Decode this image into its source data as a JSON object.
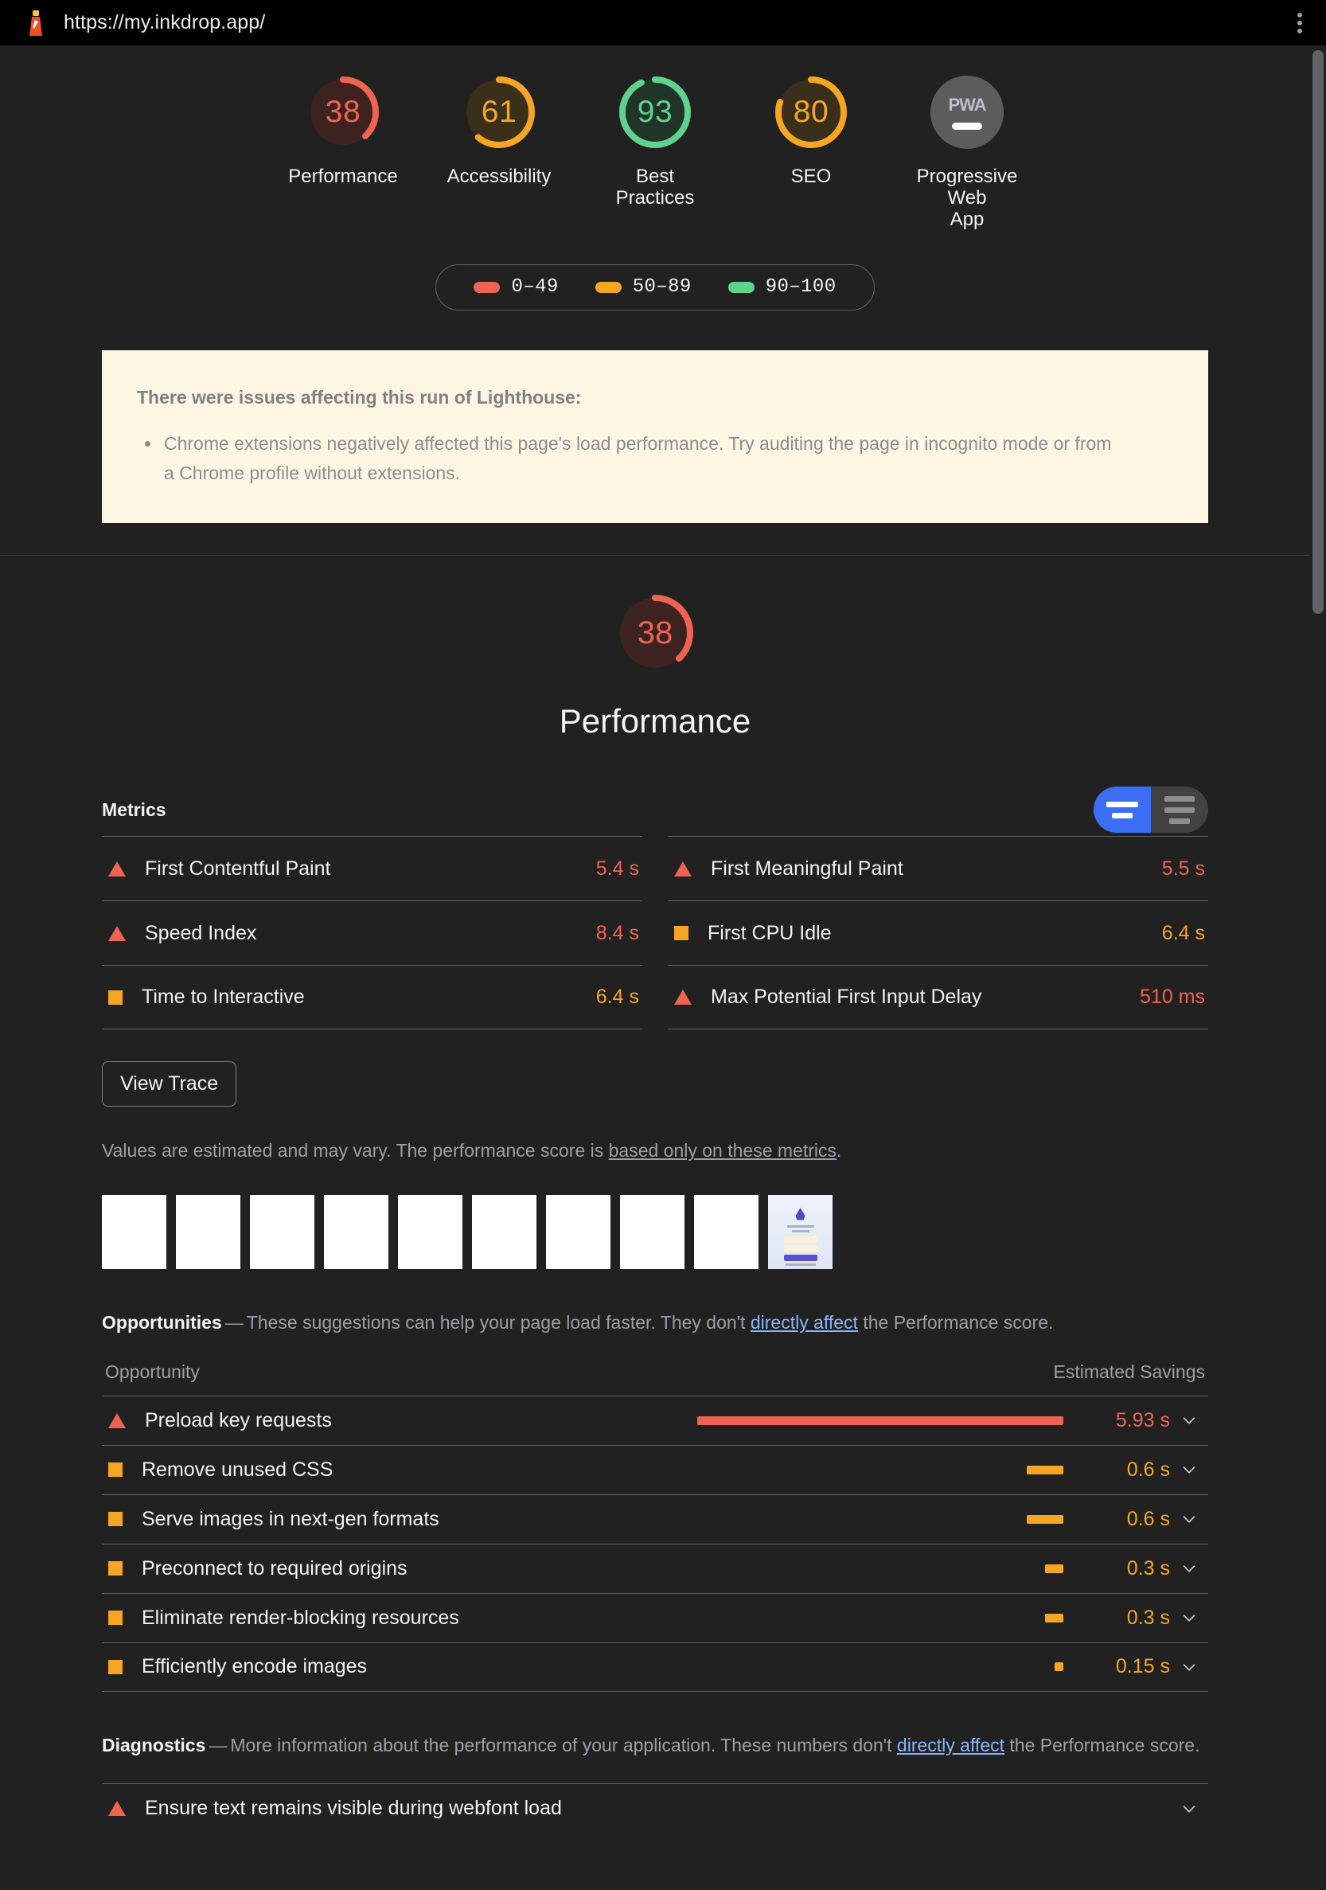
{
  "browser": {
    "url": "https://my.inkdrop.app/",
    "favicon_icon": "lighthouse-icon",
    "menu_icon": "kebab-menu-icon"
  },
  "colors": {
    "fail": "#ee6352",
    "average": "#f5a623",
    "pass": "#5fd38c",
    "fail_bg": "#3c2320",
    "average_bg": "#3a2f1b",
    "pass_bg": "#21342a",
    "link": "#8ab4f8",
    "accent_blue": "#3b6ef5"
  },
  "scores": [
    {
      "value": "38",
      "label": "Performance",
      "rating": "fail"
    },
    {
      "value": "61",
      "label": "Accessibility",
      "rating": "average"
    },
    {
      "value": "93",
      "label": "Best Practices",
      "rating": "pass"
    },
    {
      "value": "80",
      "label": "SEO",
      "rating": "average"
    },
    {
      "value": "PWA",
      "label": "Progressive Web App",
      "rating": "none"
    }
  ],
  "legend": [
    {
      "range": "0–49",
      "color": "#ee6352"
    },
    {
      "range": "50–89",
      "color": "#f5a623"
    },
    {
      "range": "90–100",
      "color": "#5fd38c"
    }
  ],
  "warning": {
    "title": "There were issues affecting this run of Lighthouse:",
    "items": [
      "Chrome extensions negatively affected this page's load performance. Try auditing the page in incognito mode or from a Chrome profile without extensions."
    ]
  },
  "performance": {
    "score": "38",
    "rating": "fail",
    "title": "Performance",
    "metrics_heading": "Metrics",
    "toggle": {
      "expanded_icon": "collapsed-view-icon",
      "description_icon": "description-view-icon"
    },
    "metrics_left": [
      {
        "name": "First Contentful Paint",
        "value": "5.4 s",
        "rating": "fail"
      },
      {
        "name": "Speed Index",
        "value": "8.4 s",
        "rating": "fail"
      },
      {
        "name": "Time to Interactive",
        "value": "6.4 s",
        "rating": "average"
      }
    ],
    "metrics_right": [
      {
        "name": "First Meaningful Paint",
        "value": "5.5 s",
        "rating": "fail"
      },
      {
        "name": "First CPU Idle",
        "value": "6.4 s",
        "rating": "average"
      },
      {
        "name": "Max Potential First Input Delay",
        "value": "510 ms",
        "rating": "fail"
      }
    ],
    "view_trace_label": "View Trace",
    "estimate_note_prefix": "Values are estimated and may vary. The performance score is ",
    "estimate_note_link": "based only on these metrics",
    "estimate_note_suffix": ".",
    "filmstrip_frames": 10
  },
  "opportunities": {
    "heading": "Opportunities",
    "dash": "—",
    "desc_prefix": "These suggestions can help your page load faster. They don't ",
    "desc_link": "directly affect",
    "desc_suffix": " the Performance score.",
    "col_opportunity": "Opportunity",
    "col_savings": "Estimated Savings",
    "rows": [
      {
        "title": "Preload key requests",
        "value": "5.93 s",
        "rating": "fail",
        "bar_pct": 100
      },
      {
        "title": "Remove unused CSS",
        "value": "0.6 s",
        "rating": "average",
        "bar_pct": 10
      },
      {
        "title": "Serve images in next-gen formats",
        "value": "0.6 s",
        "rating": "average",
        "bar_pct": 10
      },
      {
        "title": "Preconnect to required origins",
        "value": "0.3 s",
        "rating": "average",
        "bar_pct": 5
      },
      {
        "title": "Eliminate render-blocking resources",
        "value": "0.3 s",
        "rating": "average",
        "bar_pct": 5
      },
      {
        "title": "Efficiently encode images",
        "value": "0.15 s",
        "rating": "average",
        "bar_pct": 2.5
      }
    ]
  },
  "diagnostics": {
    "heading": "Diagnostics",
    "dash": "—",
    "desc_prefix": "More information about the performance of your application. These numbers don't ",
    "desc_link": "directly affect",
    "desc_suffix": " the Performance score.",
    "rows": [
      {
        "title": "Ensure text remains visible during webfont load",
        "rating": "fail"
      }
    ]
  }
}
